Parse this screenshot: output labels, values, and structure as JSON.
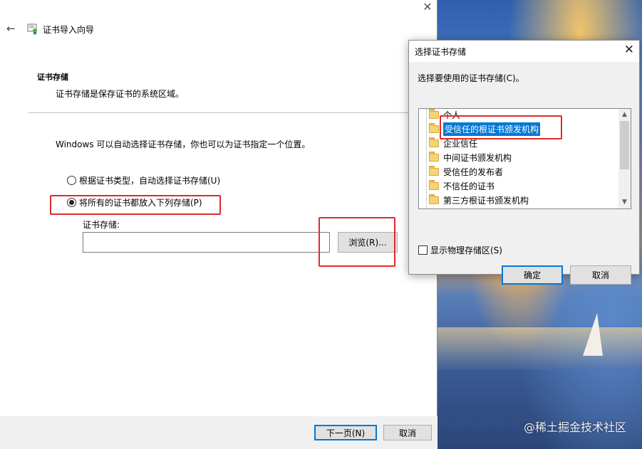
{
  "wizard": {
    "close_glyph": "✕",
    "back_glyph": "←",
    "title": "证书导入向导",
    "section_title": "证书存储",
    "section_desc": "证书存储是保存证书的系统区域。",
    "info": "Windows 可以自动选择证书存储，你也可以为证书指定一个位置。",
    "radio_auto_label": "根据证书类型，自动选择证书存储(U)",
    "radio_manual_label": "将所有的证书都放入下列存储(P)",
    "store_label": "证书存储:",
    "store_value": "",
    "browse_label": "浏览(R)...",
    "next_label": "下一页(N)",
    "cancel_label": "取消"
  },
  "dialog": {
    "title": "选择证书存储",
    "close_glyph": "✕",
    "prompt": "选择要使用的证书存储(C)。",
    "stores": [
      "个人",
      "受信任的根证书颁发机构",
      "企业信任",
      "中间证书颁发机构",
      "受信任的发布者",
      "不信任的证书",
      "第三方根证书颁发机构"
    ],
    "selected_store": "受信任的根证书颁发机构",
    "show_physical_label": "显示物理存储区(S)",
    "show_physical_checked": false,
    "ok_label": "确定",
    "cancel_label": "取消"
  },
  "watermark": "@稀土掘金技术社区",
  "colors": {
    "accent": "#0078d7",
    "annotation": "#e02a2a"
  }
}
